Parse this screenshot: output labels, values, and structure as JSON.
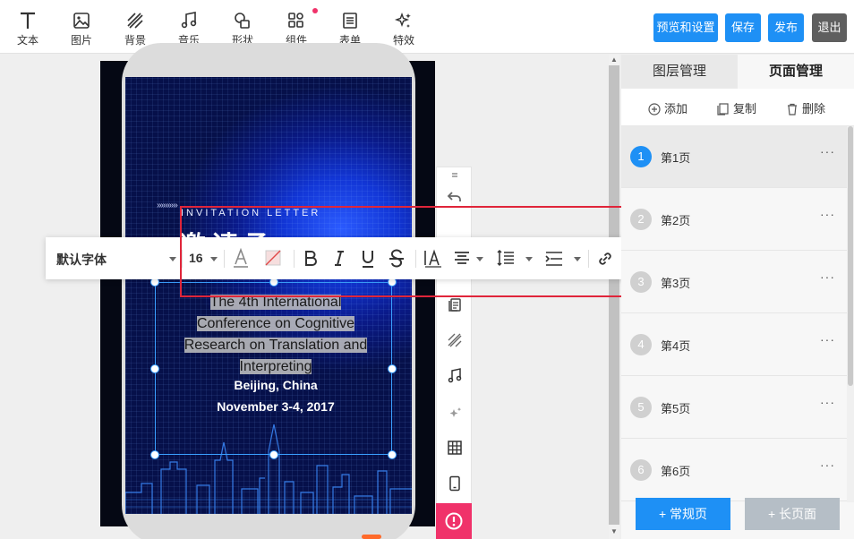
{
  "toolbar": {
    "tools": [
      {
        "label": "文本",
        "icon": "text-icon"
      },
      {
        "label": "图片",
        "icon": "image-icon"
      },
      {
        "label": "背景",
        "icon": "background-icon"
      },
      {
        "label": "音乐",
        "icon": "music-icon"
      },
      {
        "label": "形状",
        "icon": "shape-icon"
      },
      {
        "label": "组件",
        "icon": "component-icon"
      },
      {
        "label": "表单",
        "icon": "form-icon"
      },
      {
        "label": "特效",
        "icon": "effect-icon"
      }
    ],
    "buttons": {
      "preview": "预览和设置",
      "save": "保存",
      "publish": "发布",
      "exit": "退出"
    }
  },
  "canvas": {
    "invitation_letter": "INVITATION LETTER",
    "chevrons": "»»»»»",
    "big_title": "邀请函",
    "conference_lines": [
      "The 4th International",
      "Conference on Cognitive",
      "Research on Translation and",
      "Interpreting"
    ],
    "place": "Beijing, China",
    "date": "November 3-4, 2017"
  },
  "format_toolbar": {
    "font_name": "默认字体",
    "font_size": "16"
  },
  "right_panel": {
    "tabs": [
      "图层管理",
      "页面管理"
    ],
    "active_tab": "页面管理",
    "actions": {
      "add": "添加",
      "copy": "复制",
      "delete": "删除"
    },
    "pages": [
      {
        "num": "1",
        "name": "第1页",
        "active": true
      },
      {
        "num": "2",
        "name": "第2页",
        "active": false
      },
      {
        "num": "3",
        "name": "第3页",
        "active": false
      },
      {
        "num": "4",
        "name": "第4页",
        "active": false
      },
      {
        "num": "5",
        "name": "第5页",
        "active": false
      },
      {
        "num": "6",
        "name": "第6页",
        "active": false
      }
    ],
    "more": "···",
    "bottom_buttons": {
      "normal": "+ 常规页",
      "long": "+ 长页面"
    }
  },
  "colors": {
    "primary": "#1e90f5",
    "danger": "#f0326a",
    "exit": "#5f5f5f",
    "disabled": "#b5bec6",
    "highlight_box": "#e0253a"
  }
}
